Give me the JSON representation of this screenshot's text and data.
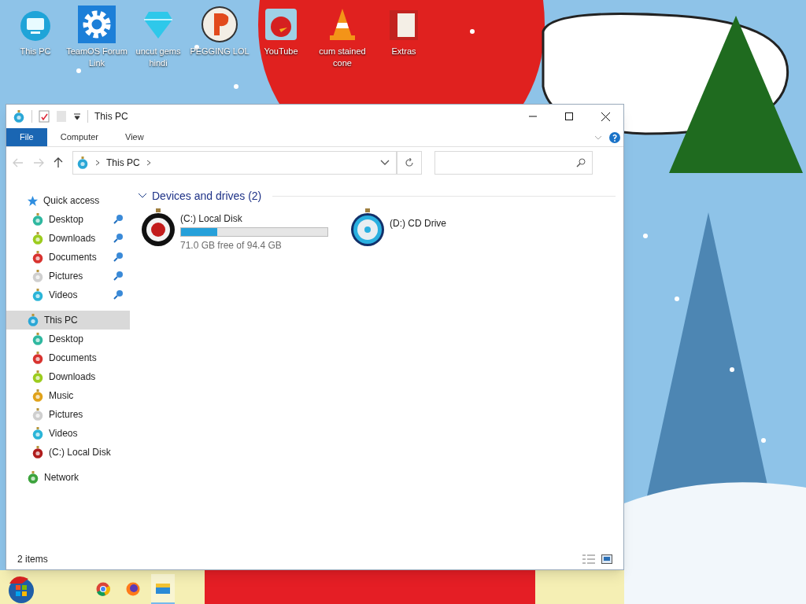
{
  "desktop_icons": [
    {
      "label": "This PC",
      "kind": "pc"
    },
    {
      "label": "TeamOS Forum Link",
      "kind": "gear"
    },
    {
      "label": "uncut gems hindi",
      "kind": "gem"
    },
    {
      "label": "PEGGING LOL",
      "kind": "p"
    },
    {
      "label": "YouTube",
      "kind": "bird"
    },
    {
      "label": "cum stained cone",
      "kind": "cone"
    },
    {
      "label": "Extras",
      "kind": "folder"
    }
  ],
  "window": {
    "title": "This PC",
    "ribbon_tabs": [
      {
        "label": "File",
        "selected": true
      },
      {
        "label": "Computer",
        "selected": false
      },
      {
        "label": "View",
        "selected": false
      }
    ],
    "address": {
      "path": "This PC"
    },
    "navigation": [
      {
        "label": "Quick access",
        "kind": "star",
        "selected": false,
        "children": [
          {
            "label": "Desktop",
            "kind": "desktop",
            "pinned": true,
            "selected": false
          },
          {
            "label": "Downloads",
            "kind": "downloads",
            "pinned": true,
            "selected": false
          },
          {
            "label": "Documents",
            "kind": "documents",
            "pinned": true,
            "selected": false
          },
          {
            "label": "Pictures",
            "kind": "pictures",
            "pinned": true,
            "selected": false
          },
          {
            "label": "Videos",
            "kind": "videos",
            "pinned": true,
            "selected": false
          }
        ]
      },
      {
        "label": "This PC",
        "kind": "pc",
        "selected": true,
        "children": [
          {
            "label": "Desktop",
            "kind": "desktop",
            "pinned": false,
            "selected": false
          },
          {
            "label": "Documents",
            "kind": "documents",
            "pinned": false,
            "selected": false
          },
          {
            "label": "Downloads",
            "kind": "downloads",
            "pinned": false,
            "selected": false
          },
          {
            "label": "Music",
            "kind": "music",
            "pinned": false,
            "selected": false
          },
          {
            "label": "Pictures",
            "kind": "pictures",
            "pinned": false,
            "selected": false
          },
          {
            "label": "Videos",
            "kind": "videos",
            "pinned": false,
            "selected": false
          },
          {
            "label": "(C:) Local Disk",
            "kind": "disk",
            "pinned": false,
            "selected": false
          }
        ]
      },
      {
        "label": "Network",
        "kind": "network",
        "selected": false
      }
    ],
    "group": {
      "title": "Devices and drives (2)",
      "expanded": true
    },
    "drives": [
      {
        "name": "(C:) Local Disk",
        "kind": "disk",
        "level": 0.248,
        "reading": "71.0 GB free of 94.4 GB"
      },
      {
        "name": "(D:) CD Drive",
        "kind": "cd"
      }
    ],
    "status_bar": {
      "text": "2 items"
    }
  },
  "taskbar": [
    {
      "kind": "chrome",
      "selected": false
    },
    {
      "kind": "firefox",
      "selected": false
    },
    {
      "kind": "explorer",
      "selected": true
    }
  ]
}
